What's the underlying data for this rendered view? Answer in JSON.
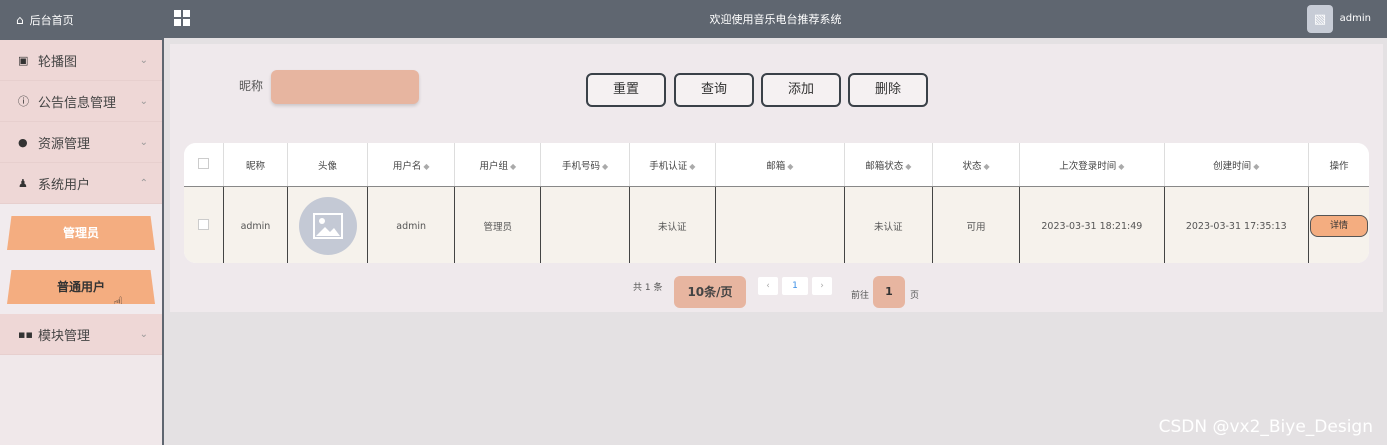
{
  "sidebar": {
    "home": "后台首页",
    "menus": [
      {
        "label": "轮播图",
        "icon": "image-icon"
      },
      {
        "label": "公告信息管理",
        "icon": "info-icon"
      },
      {
        "label": "资源管理",
        "icon": "pin-icon"
      },
      {
        "label": "系统用户",
        "icon": "user-icon"
      }
    ],
    "sub": [
      "管理员",
      "普通用户"
    ],
    "last": {
      "label": "模块管理",
      "icon": "grid-icon"
    }
  },
  "header": {
    "title": "欢迎使用音乐电台推荐系统",
    "user": "admin"
  },
  "search": {
    "label": "昵称",
    "value": ""
  },
  "buttons": {
    "reset": "重置",
    "query": "查询",
    "add": "添加",
    "delete": "删除"
  },
  "table": {
    "headers": [
      "昵称",
      "头像",
      "用户名",
      "用户组",
      "手机号码",
      "手机认证",
      "邮箱",
      "邮箱状态",
      "状态",
      "上次登录时间",
      "创建时间",
      "操作"
    ],
    "row": {
      "nickname": "admin",
      "username": "admin",
      "group": "管理员",
      "phone": "",
      "phone_auth": "未认证",
      "email": "",
      "email_state": "未认证",
      "status": "可用",
      "last_login": "2023-03-31 18:21:49",
      "created": "2023-03-31 17:35:13",
      "action": "详情"
    }
  },
  "pager": {
    "total": "共 1 条",
    "size": "10条/页",
    "current": "1",
    "goto": "前往",
    "input": "1",
    "page_unit": "页"
  },
  "watermark": "CSDN @vx2_Biye_Design"
}
